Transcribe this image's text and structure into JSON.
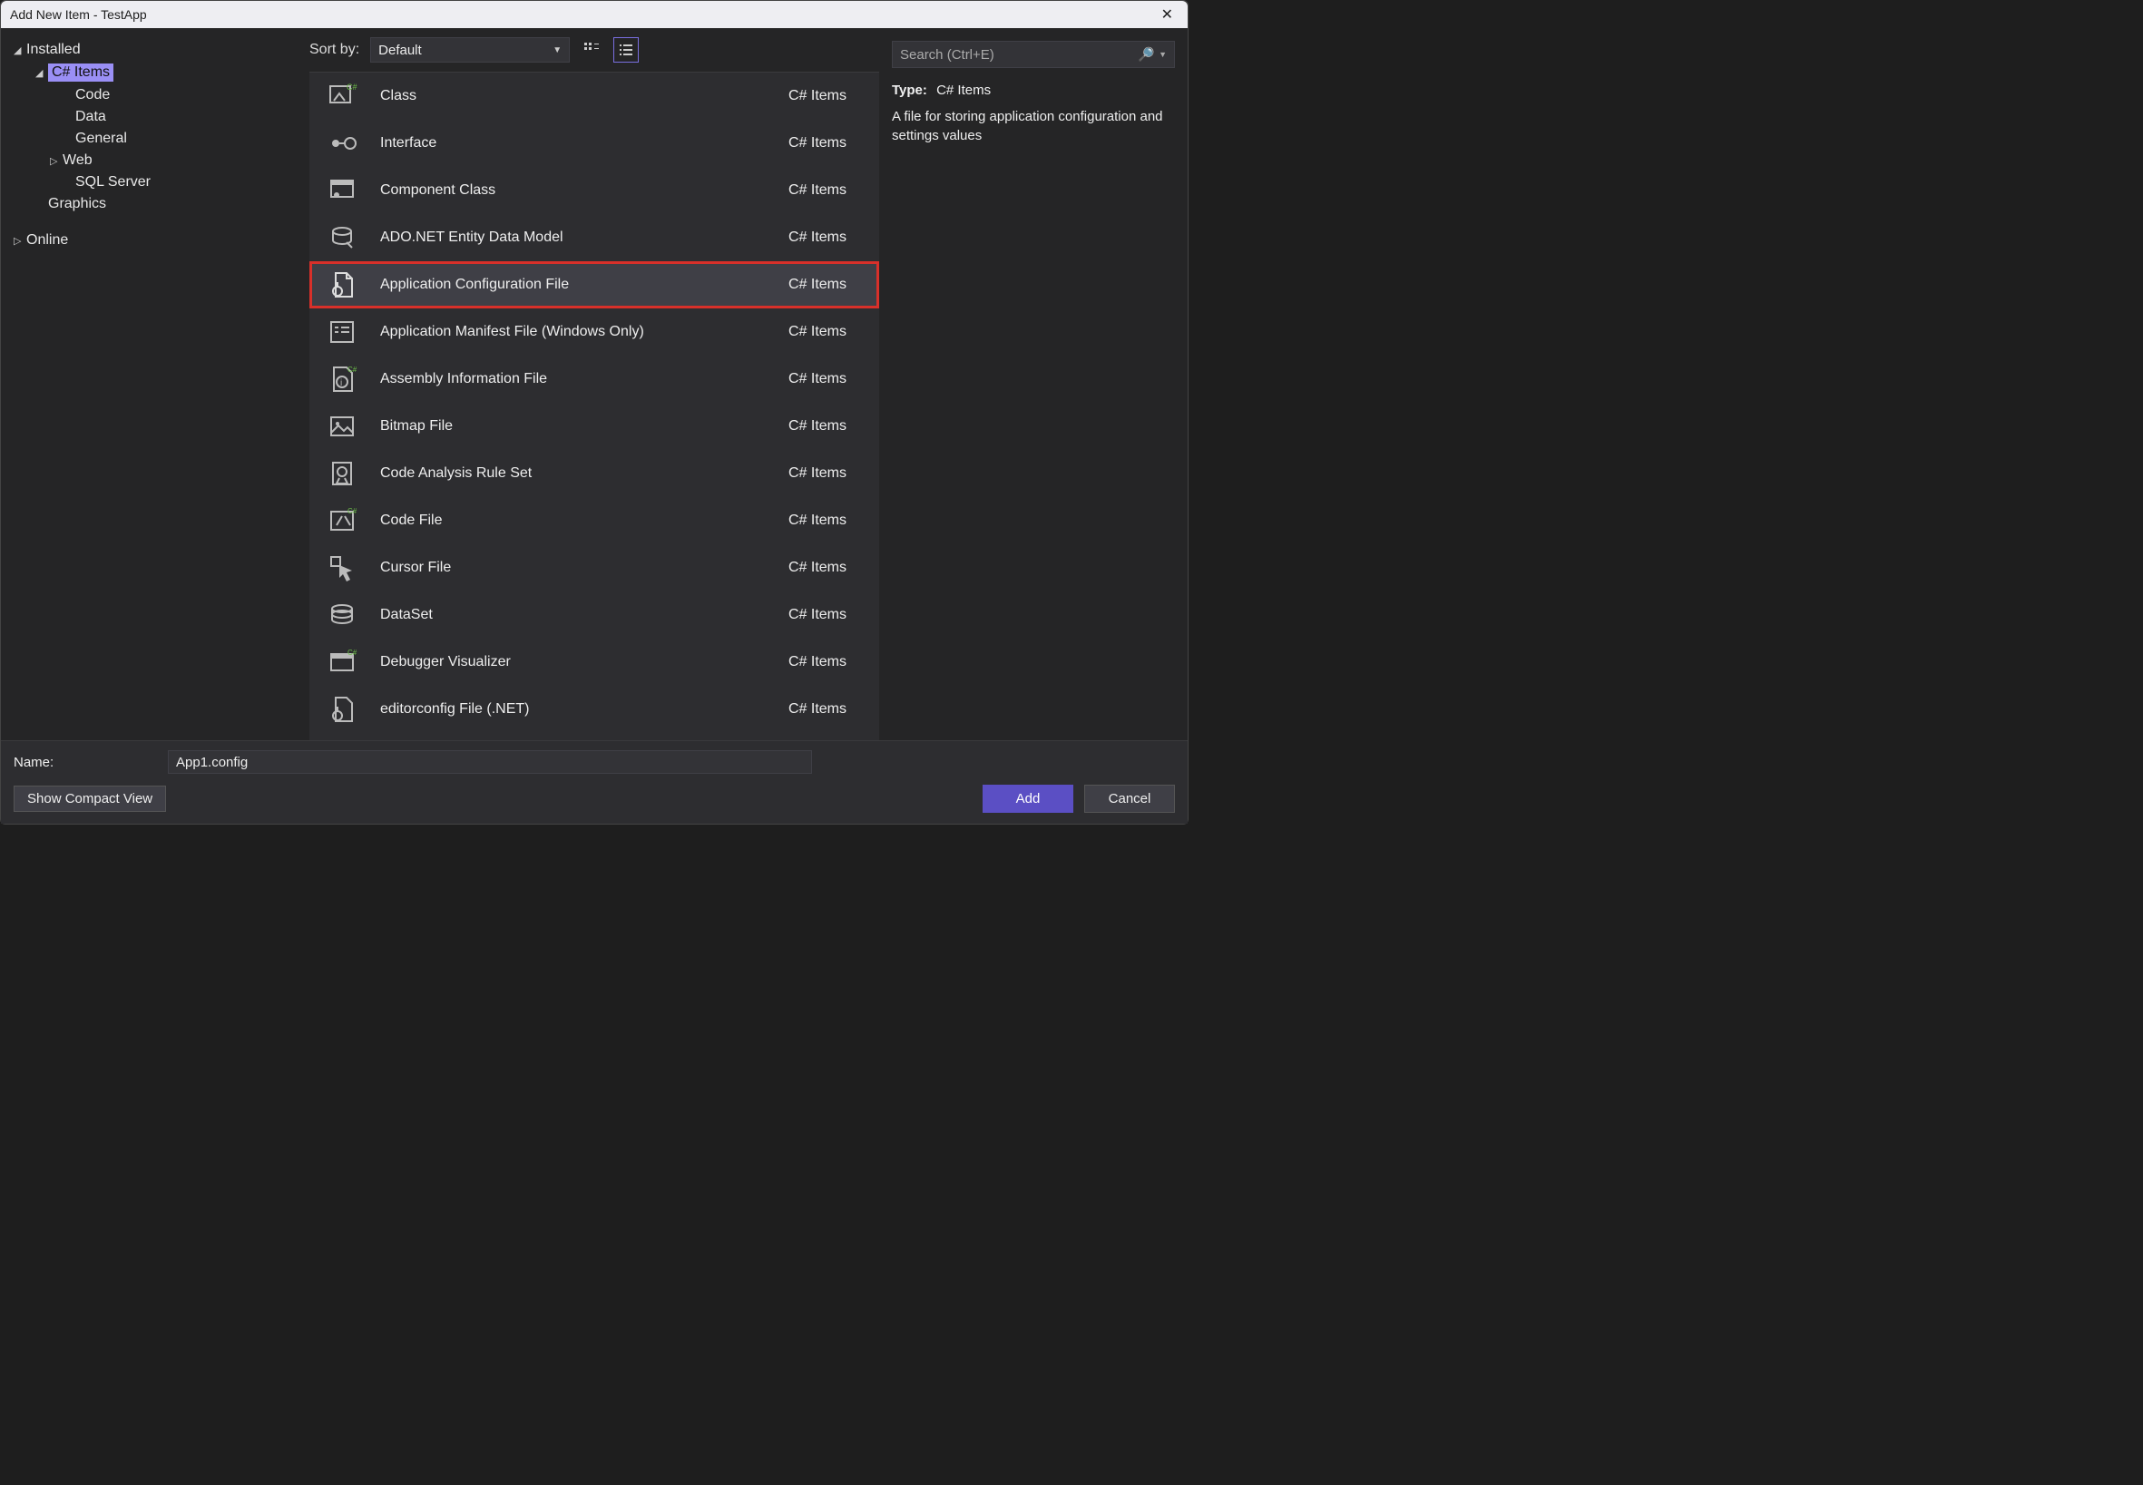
{
  "window": {
    "title": "Add New Item - TestApp"
  },
  "sidebar": {
    "installed": "Installed",
    "csitems": "C# Items",
    "code": "Code",
    "data": "Data",
    "general": "General",
    "web": "Web",
    "sqlserver": "SQL Server",
    "graphics": "Graphics",
    "online": "Online"
  },
  "toolbar": {
    "sort_label": "Sort by:",
    "sort_value": "Default"
  },
  "search": {
    "placeholder": "Search (Ctrl+E)"
  },
  "items": [
    {
      "name": "Class",
      "cat": "C# Items"
    },
    {
      "name": "Interface",
      "cat": "C# Items"
    },
    {
      "name": "Component Class",
      "cat": "C# Items"
    },
    {
      "name": "ADO.NET Entity Data Model",
      "cat": "C# Items"
    },
    {
      "name": "Application Configuration File",
      "cat": "C# Items"
    },
    {
      "name": "Application Manifest File (Windows Only)",
      "cat": "C# Items"
    },
    {
      "name": "Assembly Information File",
      "cat": "C# Items"
    },
    {
      "name": "Bitmap File",
      "cat": "C# Items"
    },
    {
      "name": "Code Analysis Rule Set",
      "cat": "C# Items"
    },
    {
      "name": "Code File",
      "cat": "C# Items"
    },
    {
      "name": "Cursor File",
      "cat": "C# Items"
    },
    {
      "name": "DataSet",
      "cat": "C# Items"
    },
    {
      "name": "Debugger Visualizer",
      "cat": "C# Items"
    },
    {
      "name": "editorconfig File (.NET)",
      "cat": "C# Items"
    }
  ],
  "detail": {
    "type_label": "Type:",
    "type_value": "C# Items",
    "description": "A file for storing application configuration and settings values"
  },
  "bottom": {
    "name_label": "Name:",
    "name_value": "App1.config",
    "compact_label": "Show Compact View",
    "add_label": "Add",
    "cancel_label": "Cancel"
  }
}
